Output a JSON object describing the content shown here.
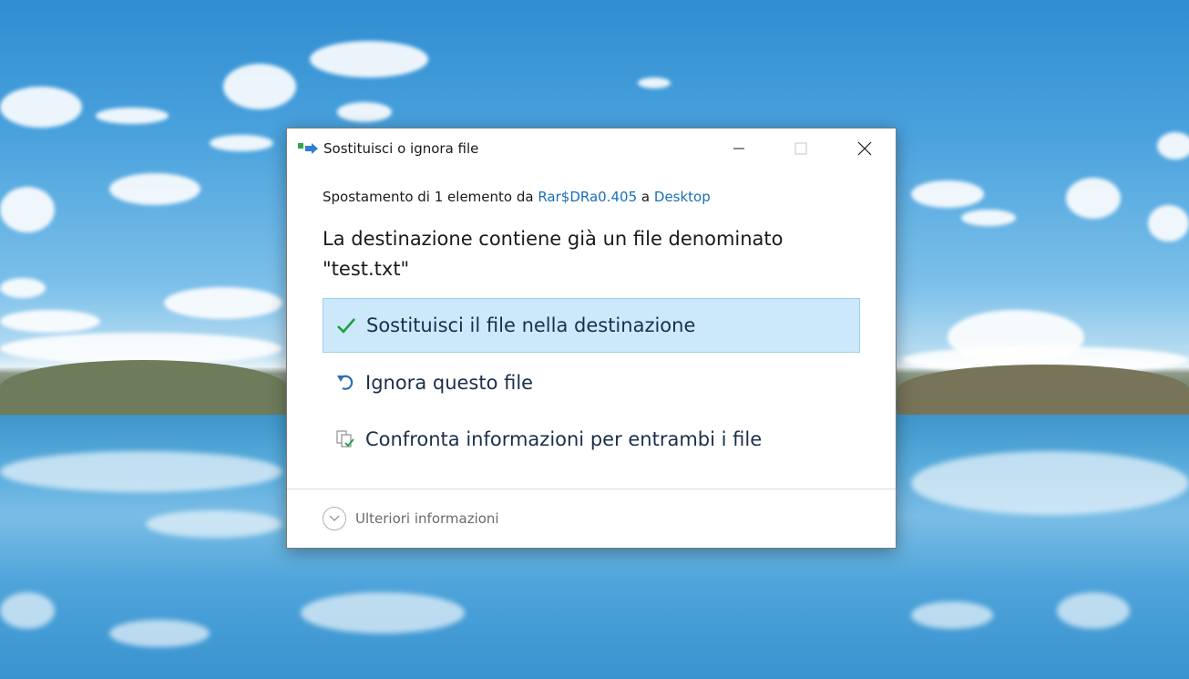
{
  "window": {
    "title": "Sostituisci o ignora file"
  },
  "info": {
    "prefix": "Spostamento di 1 elemento da",
    "source": "Rar$DRa0.405",
    "connector": "a",
    "destination": "Desktop"
  },
  "heading": "La destinazione contiene già un file denominato \"test.txt\"",
  "options": [
    {
      "label": "Sostituisci il file nella destinazione",
      "icon": "checkmark-icon",
      "selected": true
    },
    {
      "label": "Ignora questo file",
      "icon": "undo-arrow-icon",
      "selected": false
    },
    {
      "label": "Confronta informazioni per entrambi i file",
      "icon": "compare-files-icon",
      "selected": false
    }
  ],
  "more_info": {
    "label": "Ulteriori informazioni",
    "icon": "chevron-down-icon"
  },
  "colors": {
    "link": "#1a6fb5",
    "selected_bg": "#cce8fb",
    "selected_border": "#99d0f5",
    "check": "#1e9e3e"
  }
}
